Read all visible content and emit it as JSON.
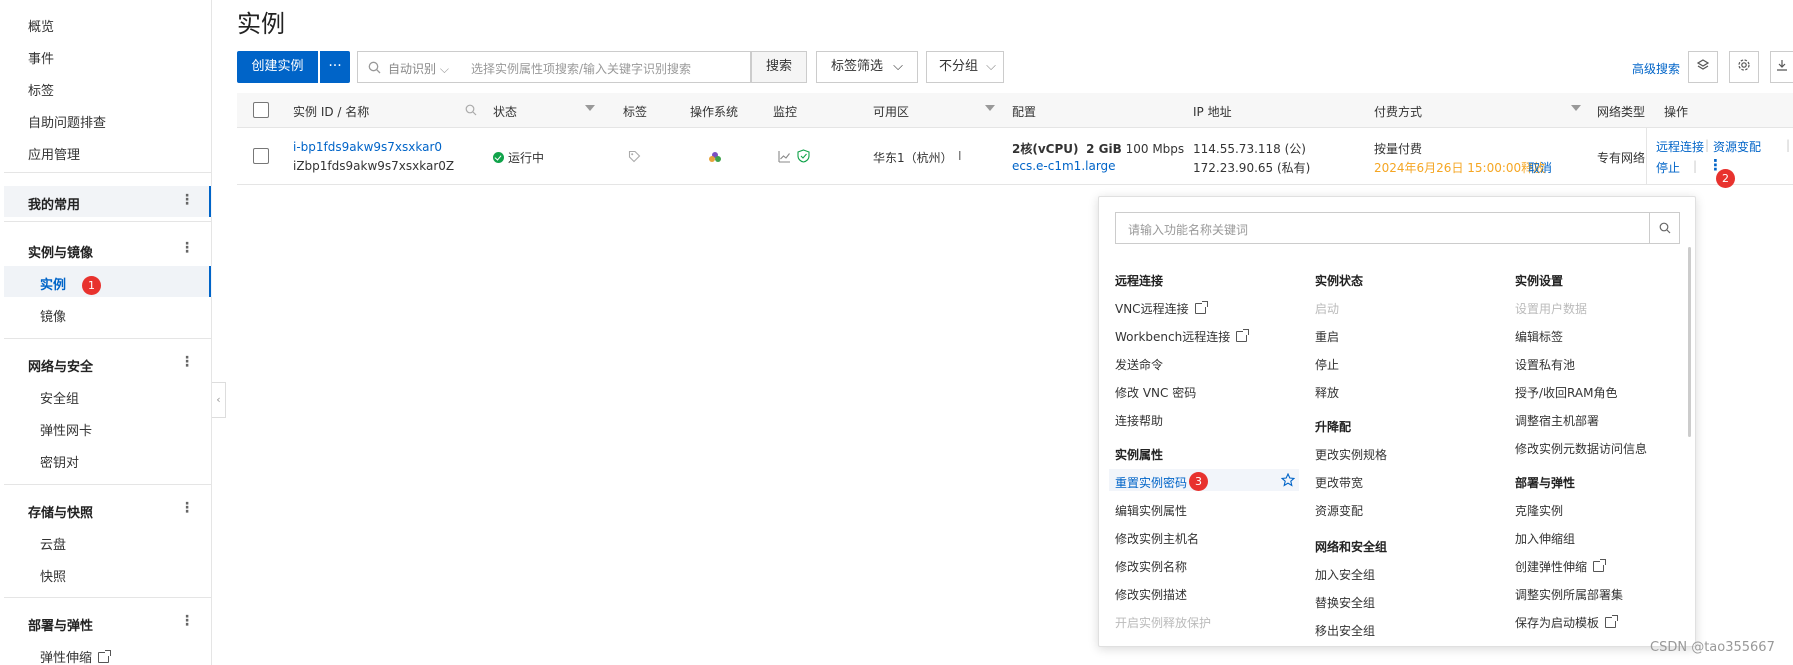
{
  "sidebar": {
    "top_items": [
      "概览",
      "事件",
      "标签",
      "自助问题排查",
      "应用管理"
    ],
    "my_frequent": "我的常用",
    "groups": [
      {
        "title": "实例与镜像",
        "items": [
          "实例",
          "镜像"
        ]
      },
      {
        "title": "网络与安全",
        "items": [
          "安全组",
          "弹性网卡",
          "密钥对"
        ]
      },
      {
        "title": "存储与快照",
        "items": [
          "云盘",
          "快照"
        ]
      },
      {
        "title": "部署与弹性",
        "items": [
          "弹性伸缩"
        ]
      }
    ],
    "active_item": "实例",
    "collapse": "‹"
  },
  "badges": {
    "b1": "1",
    "b2": "2",
    "b3": "3"
  },
  "header": {
    "title": "实例"
  },
  "toolbar": {
    "create": "创建实例",
    "more": "···",
    "search_mode": "自动识别",
    "search_placeholder": "选择实例属性项搜索/输入关键字识别搜索",
    "search_btn": "搜索",
    "tag_filter": "标签筛选",
    "group": "不分组",
    "advanced": "高级搜索"
  },
  "table": {
    "headers": [
      "实例 ID / 名称",
      "状态",
      "标签",
      "操作系统",
      "监控",
      "可用区",
      "配置",
      "IP 地址",
      "付费方式",
      "网络类型",
      "操作"
    ],
    "row": {
      "id": "i-bp1fds9akw9s7xsxkar0",
      "name": "iZbp1fds9akw9s7xsxkar0Z",
      "status": "运行中",
      "zone": "华东1（杭州）",
      "zone_sep": "I",
      "cpu": "2核(vCPU)",
      "mem": "2 GiB",
      "bw": "100 Mbps",
      "spec": "ecs.e-c1m1.large",
      "ip_public": "114.55.73.118 (公)",
      "ip_private": "172.23.90.65 (私有)",
      "billing": "按量付费",
      "release": "2024年6月26日 15:00:00释放",
      "cancel": "取消",
      "network": "专有网络",
      "ops": [
        "远程连接",
        "资源变配",
        "停止"
      ],
      "op_sep": "|",
      "more": "⋮"
    }
  },
  "dropdown": {
    "placeholder": "请输入功能名称关键词",
    "col1": {
      "h1": "远程连接",
      "items1": [
        "VNC远程连接",
        "Workbench远程连接",
        "发送命令",
        "修改 VNC 密码",
        "连接帮助"
      ],
      "h2": "实例属性",
      "items2": [
        "重置实例密码",
        "编辑实例属性",
        "修改实例主机名",
        "修改实例名称",
        "修改实例描述",
        "开启实例释放保护"
      ]
    },
    "col2": {
      "h1": "实例状态",
      "items1": [
        "启动",
        "重启",
        "停止",
        "释放"
      ],
      "h2": "升降配",
      "items2": [
        "更改实例规格",
        "更改带宽",
        "资源变配"
      ],
      "h3": "网络和安全组",
      "items3": [
        "加入安全组",
        "替换安全组",
        "移出安全组"
      ]
    },
    "col3": {
      "h1": "实例设置",
      "items1": [
        "设置用户数据",
        "编辑标签",
        "设置私有池",
        "授予/收回RAM角色",
        "调整宿主机部署",
        "修改实例元数据访问信息"
      ],
      "h2": "部署与弹性",
      "items2": [
        "克隆实例",
        "加入伸缩组",
        "创建弹性伸缩",
        "调整实例所属部署集",
        "保存为启动模板"
      ]
    }
  },
  "watermark": "CSDN @tao355667",
  "colors": {
    "primary": "#0064c8",
    "badge": "#e8322e",
    "running": "#10a34a",
    "release": "#f5a623"
  }
}
